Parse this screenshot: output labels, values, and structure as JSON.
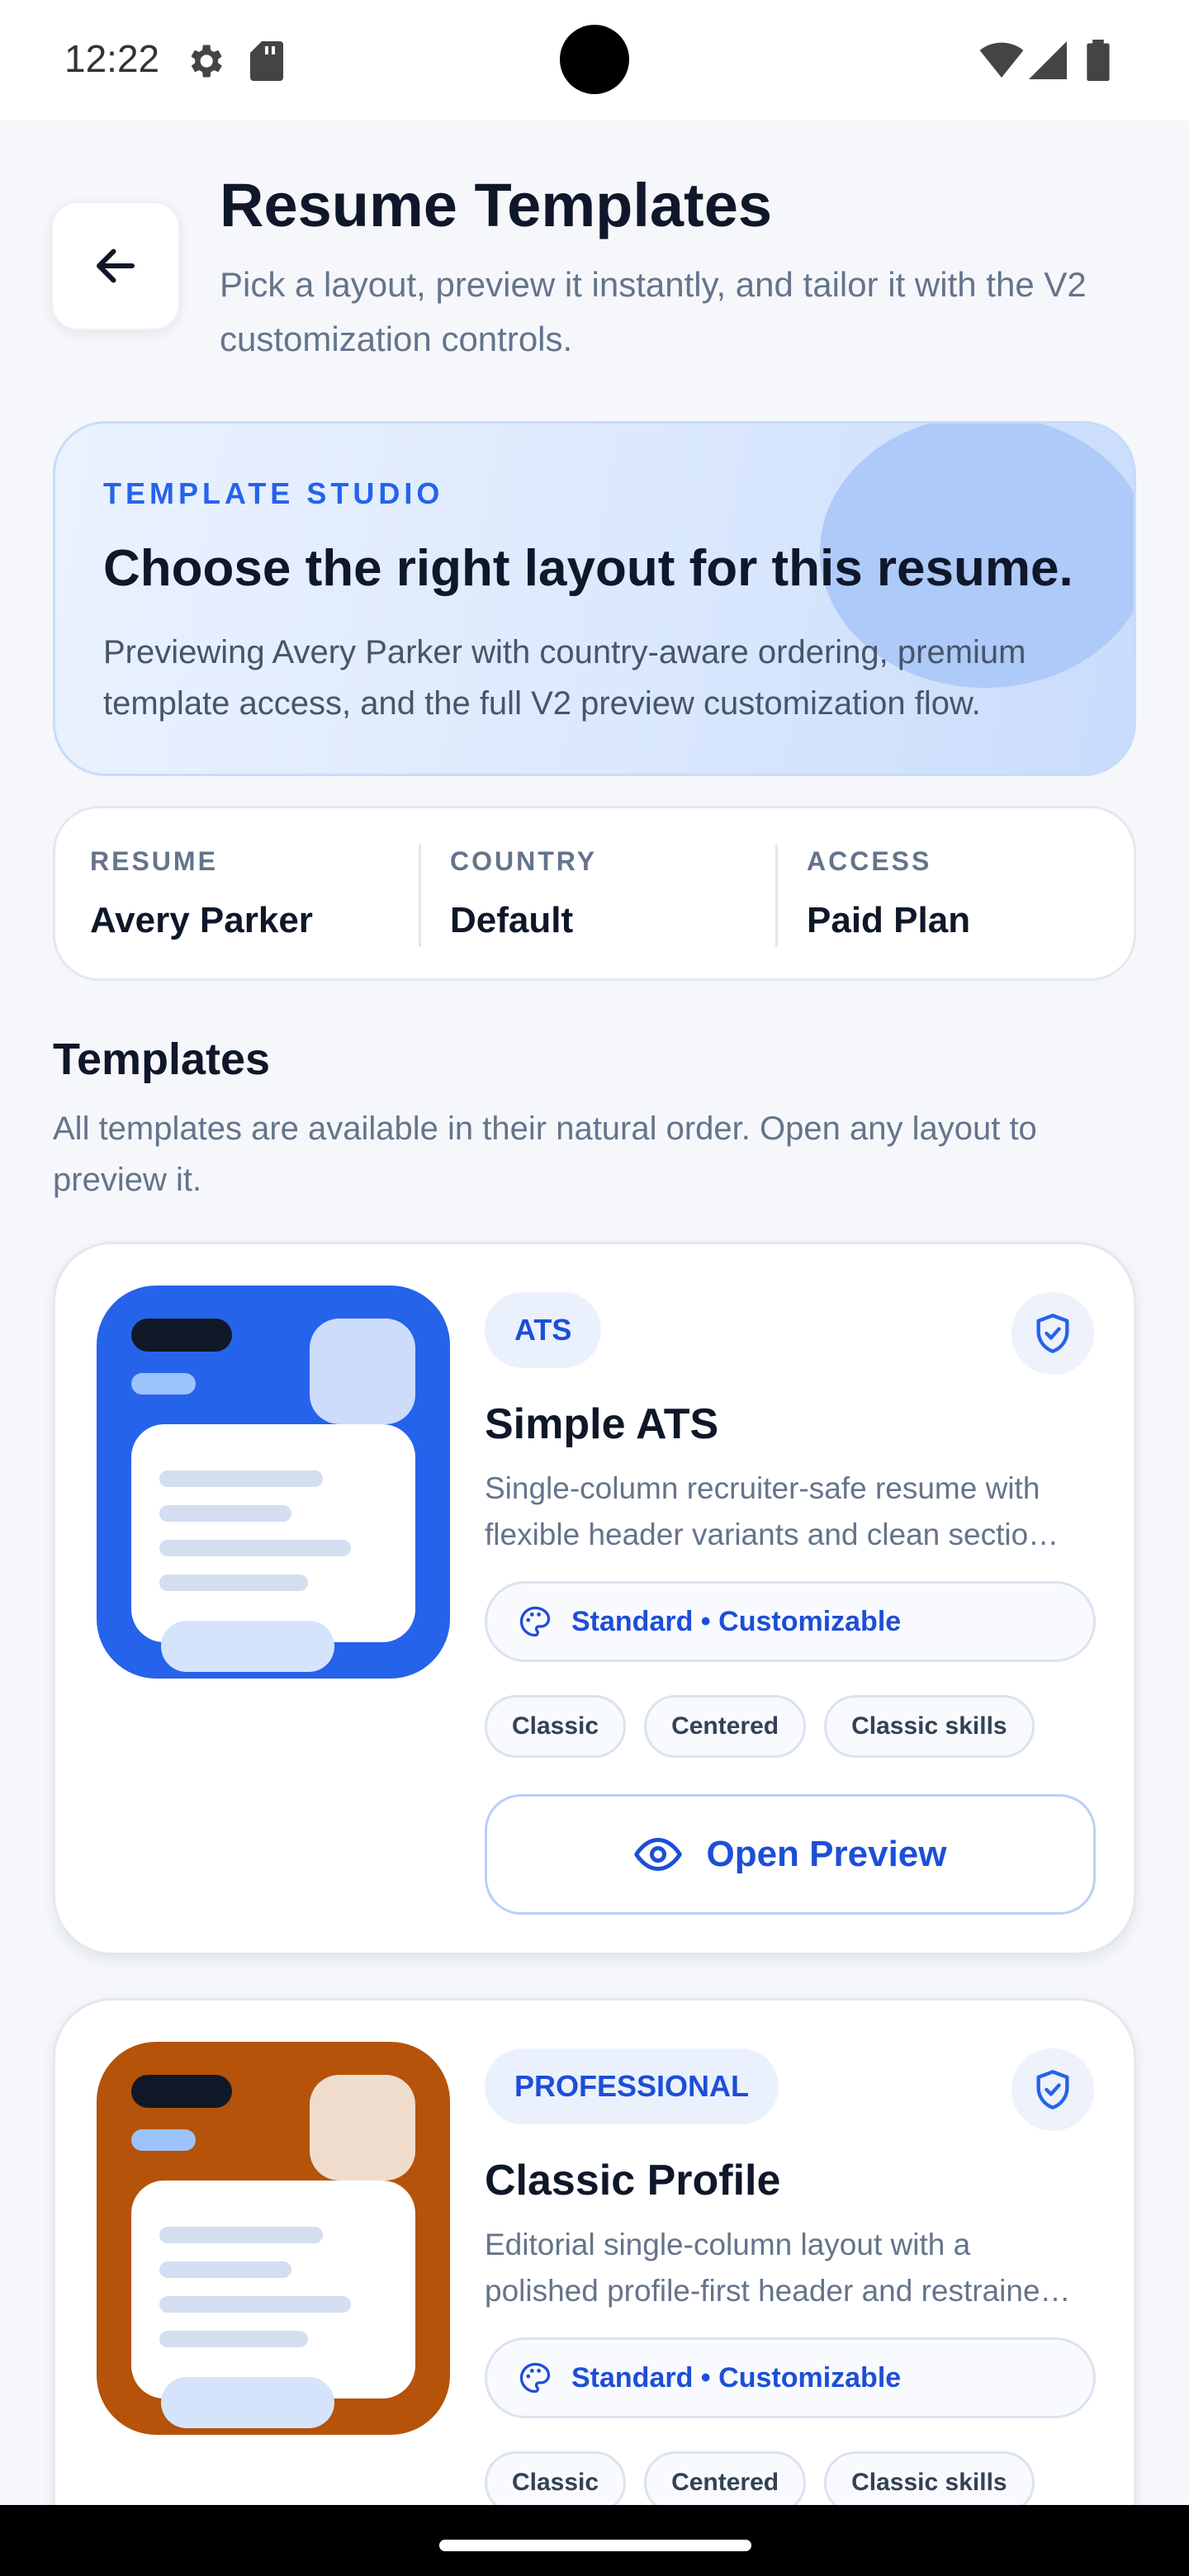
{
  "status_bar": {
    "time": "12:22"
  },
  "header": {
    "title": "Resume Templates",
    "subtitle": "Pick a layout, preview it instantly, and tailor it with the V2 customization controls."
  },
  "hero": {
    "eyebrow": "TEMPLATE STUDIO",
    "title": "Choose the right layout for this resume.",
    "description": "Previewing Avery Parker with country-aware ordering, premium template access, and the full V2 preview customization flow."
  },
  "info": [
    {
      "label": "RESUME",
      "value": "Avery Parker"
    },
    {
      "label": "COUNTRY",
      "value": "Default"
    },
    {
      "label": "ACCESS",
      "value": "Paid Plan"
    }
  ],
  "section": {
    "title": "Templates",
    "description": "All templates are available in their natural order. Open any layout to preview it."
  },
  "templates": [
    {
      "category": "ATS",
      "name": "Simple ATS",
      "description_line1": "Single-column recruiter-safe resume with",
      "description_line2": "flexible header variants and clean sectio…",
      "feature": "Standard • Customizable",
      "chips": [
        "Classic",
        "Centered",
        "Classic skills"
      ],
      "button": "Open Preview",
      "thumb_color": "#2563eb",
      "thumb_accent": "#cddcfb"
    },
    {
      "category": "PROFESSIONAL",
      "name": "Classic Profile",
      "description_line1": "Editorial single-column layout with a",
      "description_line2": "polished profile-first header and restraine…",
      "feature": "Standard • Customizable",
      "chips": [
        "Classic",
        "Centered",
        "Classic skills"
      ],
      "thumb_color": "#b45309",
      "thumb_accent": "#f0dccd"
    }
  ]
}
